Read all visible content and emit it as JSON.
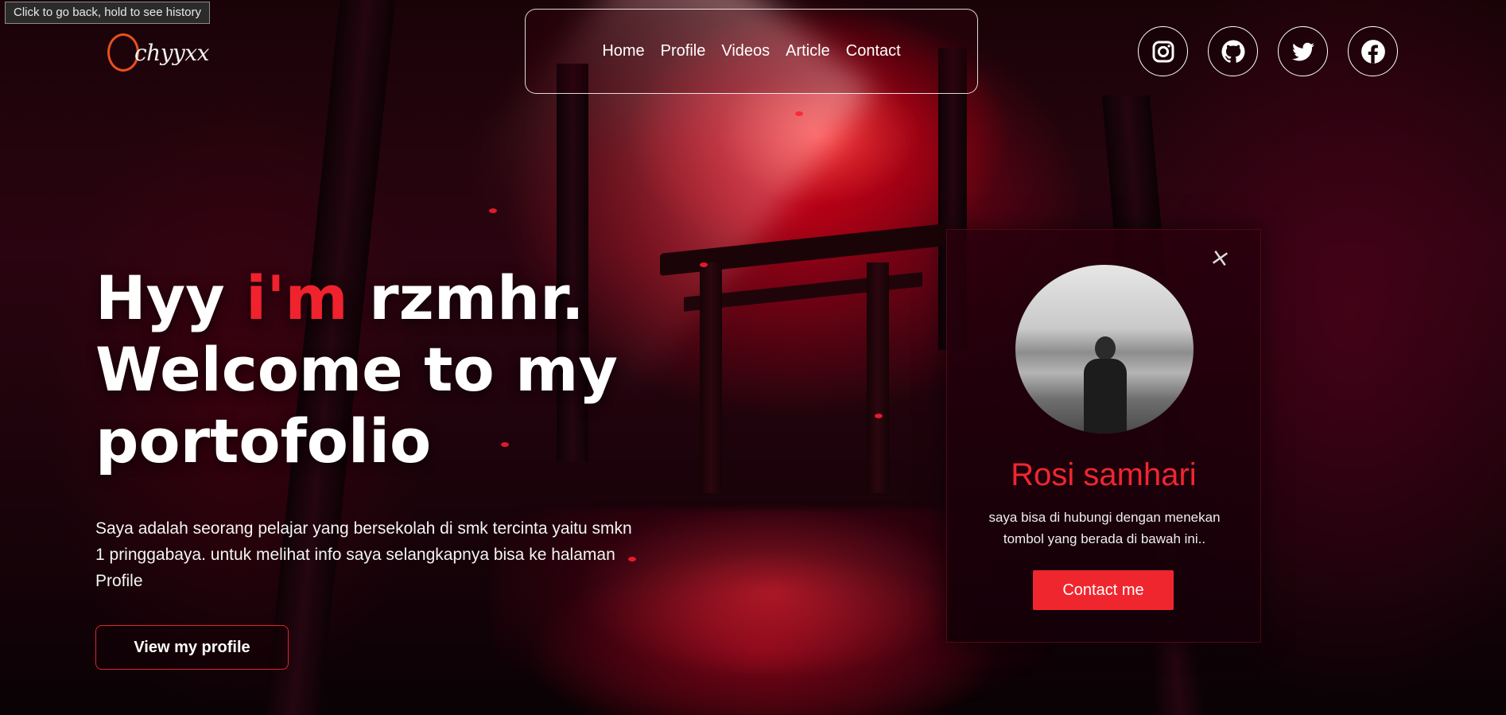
{
  "tooltip": {
    "text": "Click to go back, hold to see history"
  },
  "logo": {
    "text": "chyyxx"
  },
  "nav": {
    "items": [
      "Home",
      "Profile",
      "Videos",
      "Article",
      "Contact"
    ]
  },
  "social": {
    "icons": [
      "instagram-icon",
      "github-icon",
      "twitter-icon",
      "facebook-icon"
    ]
  },
  "hero": {
    "title_pre": "Hyy ",
    "title_accent": "i'm",
    "title_post": " rzmhr.",
    "title_line2": "Welcome to my",
    "title_line3": "portofolio",
    "description": "Saya adalah seorang pelajar yang bersekolah di smk tercinta yaitu smkn 1 pringgabaya. untuk melihat info saya selangkapnya bisa ke halaman Profile",
    "button_label": "View my profile"
  },
  "card": {
    "close_symbol": "×",
    "name": "Rosi samhari",
    "info": "saya bisa di hubungi dengan menekan tombol yang berada di bawah ini..",
    "button_label": "Contact me"
  },
  "colors": {
    "accent": "#f0262f",
    "logo_ring": "#e8501e"
  }
}
